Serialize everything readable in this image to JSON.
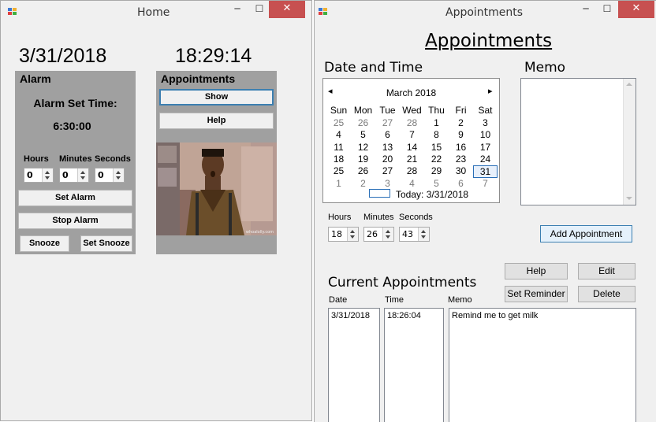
{
  "home": {
    "title": "Home",
    "controls": {
      "minimize": "─",
      "maximize": "☐",
      "close": "✕"
    },
    "date": "3/31/2018",
    "time": "18:29:14",
    "alarm": {
      "header": "Alarm",
      "set_time_label": "Alarm Set Time:",
      "set_time_value": "6:30:00",
      "hours_label": "Hours",
      "minutes_label": "Minutes",
      "seconds_label": "Seconds",
      "hours_value": "0",
      "minutes_value": "0",
      "seconds_value": "0",
      "set_alarm": "Set Alarm",
      "stop_alarm": "Stop Alarm",
      "snooze": "Snooze",
      "set_snooze": "Set Snooze"
    },
    "appointments": {
      "header": "Appointments",
      "show": "Show",
      "help": "Help",
      "image_caption": "whoalolly.com"
    }
  },
  "appts": {
    "title": "Appointments",
    "controls": {
      "minimize": "─",
      "maximize": "☐",
      "close": "✕"
    },
    "heading": "Appointments",
    "date_time_label": "Date and Time",
    "memo_label": "Memo",
    "calendar": {
      "month": "March 2018",
      "prev": "◂",
      "next": "▸",
      "weekdays": [
        "Sun",
        "Mon",
        "Tue",
        "Wed",
        "Thu",
        "Fri",
        "Sat"
      ],
      "weeks": [
        [
          "25",
          "26",
          "27",
          "28",
          "1",
          "2",
          "3"
        ],
        [
          "4",
          "5",
          "6",
          "7",
          "8",
          "9",
          "10"
        ],
        [
          "11",
          "12",
          "13",
          "14",
          "15",
          "16",
          "17"
        ],
        [
          "18",
          "19",
          "20",
          "21",
          "22",
          "23",
          "24"
        ],
        [
          "25",
          "26",
          "27",
          "28",
          "29",
          "30",
          "31"
        ],
        [
          "1",
          "2",
          "3",
          "4",
          "5",
          "6",
          "7"
        ]
      ],
      "today_label": "Today: 3/31/2018"
    },
    "hours_label": "Hours",
    "minutes_label": "Minutes",
    "seconds_label": "Seconds",
    "hours_value": "18",
    "minutes_value": "26",
    "seconds_value": "43",
    "add_appointment": "Add Appointment",
    "current_label": "Current Appointments",
    "help": "Help",
    "edit": "Edit",
    "set_reminder": "Set Reminder",
    "delete": "Delete",
    "col_date": "Date",
    "col_time": "Time",
    "col_memo": "Memo",
    "list_date": [
      "3/31/2018"
    ],
    "list_time": [
      "18:26:04"
    ],
    "list_memo": [
      "Remind me to get milk"
    ]
  }
}
